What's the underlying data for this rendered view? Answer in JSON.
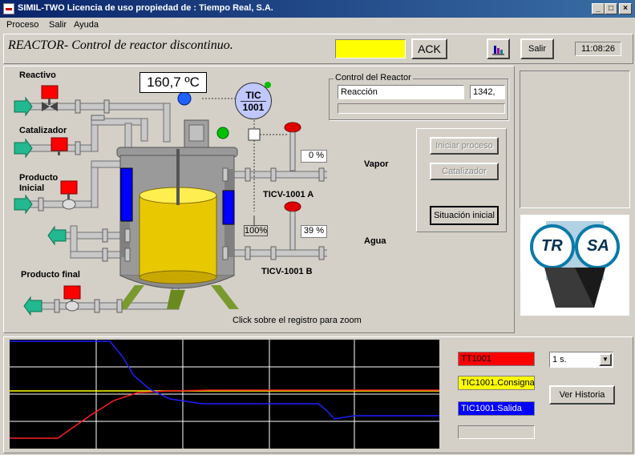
{
  "window": {
    "title": "SIMIL-TWO Licencia de uso propiedad de : Tiempo Real, S.A."
  },
  "menu": [
    "Proceso",
    "Salir",
    "Ayuda"
  ],
  "header": {
    "title": "REACTOR- Control de reactor discontinuo.",
    "ack_label": "ACK",
    "exit_label": "Salir",
    "clock": "11:08:26",
    "alarm_color": "#ffff00"
  },
  "process": {
    "labels": {
      "reactivo": "Reactivo",
      "catalizador": "Catalizador",
      "producto_inicial": "Producto Inicial",
      "producto_final": "Producto final",
      "vapor": "Vapor",
      "agua": "Agua"
    },
    "temperature": "160,7 ºC",
    "controller": {
      "line1": "TIC",
      "line2": "1001"
    },
    "valve_a": {
      "tag": "TICV-1001 A",
      "opening": "0 %"
    },
    "valve_b": {
      "tag": "TICV-1001 B",
      "opening": "39 %"
    },
    "level": "100%",
    "hint": "Click sobre el registro para zoom"
  },
  "control": {
    "group_label": "Control del Reactor",
    "phase": "Reacción",
    "phase_value": "1342,",
    "buttons": {
      "start": "Iniciar proceso",
      "catalyst": "Catalizador",
      "initial": "Situación inicial"
    }
  },
  "logo": {
    "left": "TR",
    "right": "SA"
  },
  "trend": {
    "legends": [
      {
        "label": "TT1001",
        "color": "#ff0000"
      },
      {
        "label": "TIC1001.Consigna",
        "color": "#ffff00"
      },
      {
        "label": "TIC1001.Salida",
        "color": "#0000ff"
      }
    ],
    "interval": "1 s.",
    "history_label": "Ver Historia"
  }
}
